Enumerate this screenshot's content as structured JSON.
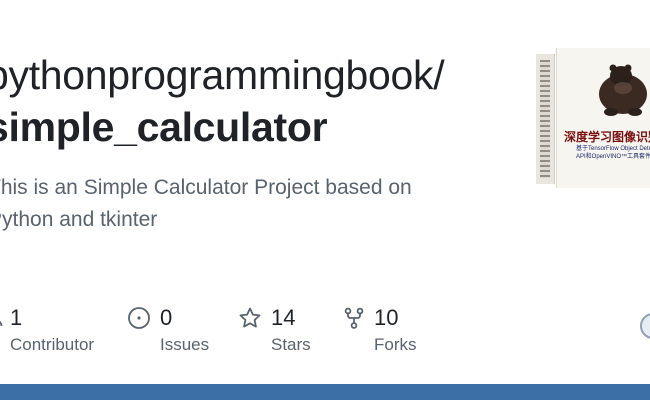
{
  "repo": {
    "owner": "pythonprogrammingbook/",
    "name": "simple_calculator",
    "description": "This is an Simple Calculator Project based on Python and tkinter"
  },
  "stats": [
    {
      "icon": "people-icon",
      "value": "1",
      "label": "Contributor"
    },
    {
      "icon": "issue-icon",
      "value": "0",
      "label": "Issues"
    },
    {
      "icon": "star-icon",
      "value": "14",
      "label": "Stars"
    },
    {
      "icon": "fork-icon",
      "value": "10",
      "label": "Forks"
    }
  ],
  "book": {
    "title": "深度学习图像识别技",
    "subtitle": "基于TensorFlow Object Detection API和OpenVINO™工具套件"
  },
  "colors": {
    "text": "#1f2328",
    "muted": "#59636e",
    "bottom_bar": "#3c6fa5",
    "book_title": "#7a1010"
  }
}
